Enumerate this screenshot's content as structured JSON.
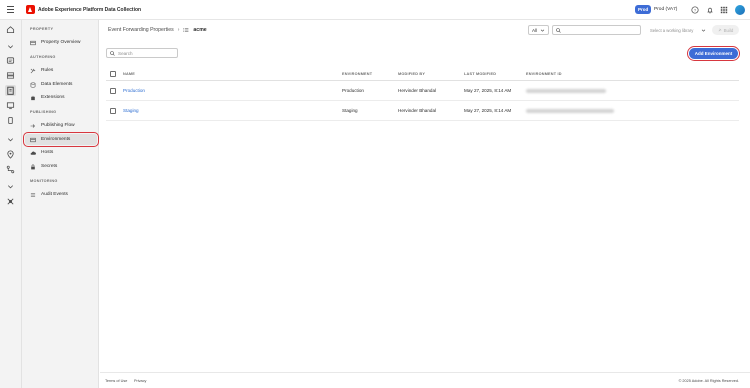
{
  "app": {
    "title": "Adobe Experience Platform Data Collection",
    "environment_badge": "Prod",
    "org_name": "Prod (VA7)"
  },
  "sidebar": {
    "sections": [
      {
        "label": "PROPERTY"
      },
      {
        "label": "AUTHORING"
      },
      {
        "label": "PUBLISHING"
      },
      {
        "label": "MONITORING"
      }
    ],
    "items": [
      {
        "label": "Property Overview",
        "icon": "property-icon"
      },
      {
        "label": "Rules",
        "icon": "rules-icon"
      },
      {
        "label": "Data Elements",
        "icon": "data-elements-icon"
      },
      {
        "label": "Extensions",
        "icon": "extensions-icon"
      },
      {
        "label": "Publishing Flow",
        "icon": "publishing-flow-icon"
      },
      {
        "label": "Environments",
        "icon": "environments-icon",
        "active": true
      },
      {
        "label": "Hosts",
        "icon": "hosts-icon"
      },
      {
        "label": "Secrets",
        "icon": "lock-icon"
      },
      {
        "label": "Audit Events",
        "icon": "audit-icon"
      }
    ]
  },
  "breadcrumb": {
    "parent": "Event Forwarding Properties",
    "separator": "›",
    "current": "acme"
  },
  "toolbar": {
    "filter_value": "All",
    "library_placeholder": "Select a working library",
    "build_label": "Build"
  },
  "list": {
    "search_placeholder": "Search",
    "add_button_label": "Add Environment",
    "columns": [
      "NAME",
      "ENVIRONMENT",
      "MODIFIED BY",
      "LAST MODIFIED",
      "ENVIRONMENT ID"
    ],
    "rows": [
      {
        "name": "Production",
        "environment": "Production",
        "modified_by": "Hervinder Bhandal",
        "last_modified": "May 27, 2025, 8:14 AM"
      },
      {
        "name": "Staging",
        "environment": "Staging",
        "modified_by": "Hervinder Bhandal",
        "last_modified": "May 27, 2025, 8:14 AM"
      }
    ]
  },
  "footer": {
    "terms": "Terms of Use",
    "privacy": "Privacy",
    "copyright": "© 2025 Adobe. All Rights Reserved."
  },
  "colors": {
    "accent": "#3d6cd6",
    "highlight": "#d7373f",
    "link": "#2b6cd1"
  }
}
